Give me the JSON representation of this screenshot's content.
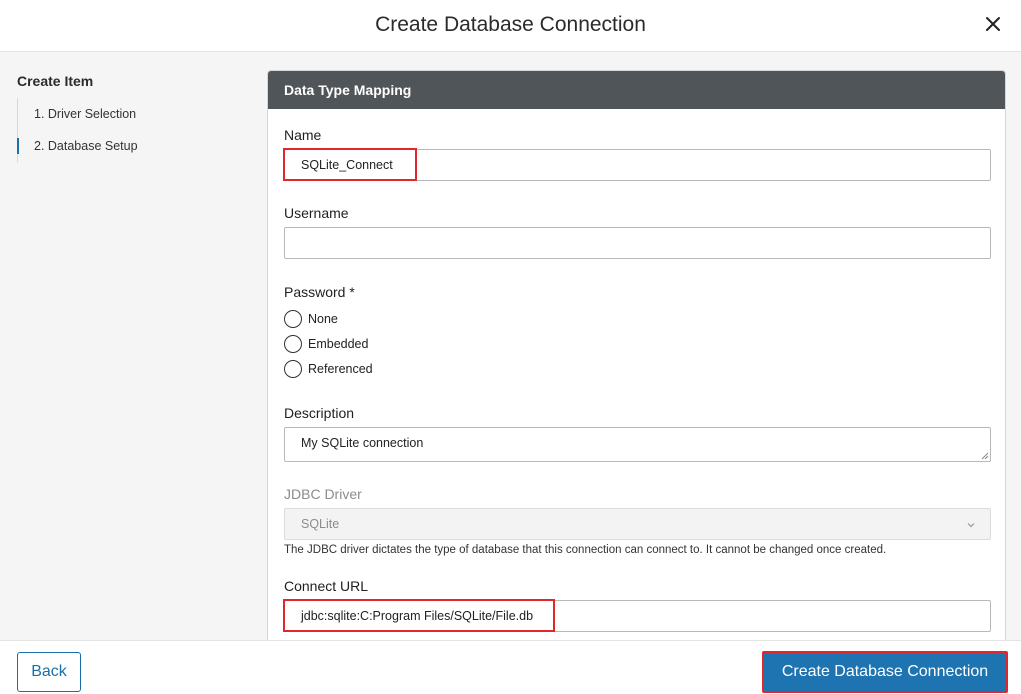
{
  "dialog": {
    "title": "Create Database Connection"
  },
  "sidebar": {
    "heading": "Create Item",
    "steps": [
      {
        "label": "1. Driver Selection"
      },
      {
        "label": "2. Database Setup"
      }
    ],
    "active_step": 1
  },
  "panel": {
    "title": "Data Type Mapping",
    "name": {
      "label": "Name",
      "value": "SQLite_Connect"
    },
    "username": {
      "label": "Username",
      "value": ""
    },
    "password": {
      "label": "Password *",
      "options": [
        {
          "label": "None"
        },
        {
          "label": "Embedded"
        },
        {
          "label": "Referenced"
        }
      ]
    },
    "description": {
      "label": "Description",
      "value": "My SQLite connection"
    },
    "jdbc_driver": {
      "label": "JDBC Driver",
      "value": "SQLite",
      "help": "The JDBC driver dictates the type of database that this connection can connect to. It cannot be changed once created."
    },
    "connect_url": {
      "label": "Connect URL",
      "value": "jdbc:sqlite:C:Program Files/SQLite/File.db"
    }
  },
  "footer": {
    "back_label": "Back",
    "create_label": "Create Database Connection"
  },
  "icons": {
    "close": "close-icon",
    "dropdown": "chevron-down-icon"
  },
  "colors": {
    "primary": "#1e73b1",
    "panel_header": "#505559",
    "highlight": "#e0282c"
  }
}
